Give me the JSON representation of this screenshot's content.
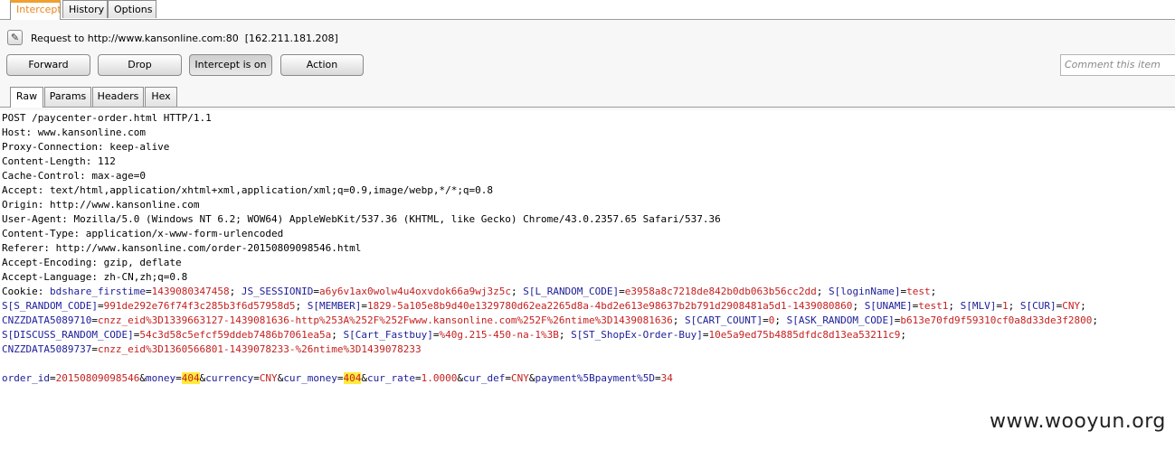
{
  "top_tabs": [
    "Intercept",
    "History",
    "Options"
  ],
  "request": {
    "label": "Request to http://www.kansonline.com:80",
    "ip": "[162.211.181.208]"
  },
  "buttons": {
    "forward": "Forward",
    "drop": "Drop",
    "intercept": "Intercept is on",
    "action": "Action"
  },
  "comment_placeholder": "Comment this item",
  "sub_tabs": [
    "Raw",
    "Params",
    "Headers",
    "Hex"
  ],
  "headers": [
    "POST /paycenter-order.html HTTP/1.1",
    "Host: www.kansonline.com",
    "Proxy-Connection: keep-alive",
    "Content-Length: 112",
    "Cache-Control: max-age=0",
    "Accept: text/html,application/xhtml+xml,application/xml;q=0.9,image/webp,*/*;q=0.8",
    "Origin: http://www.kansonline.com",
    "User-Agent: Mozilla/5.0 (Windows NT 6.2; WOW64) AppleWebKit/537.36 (KHTML, like Gecko) Chrome/43.0.2357.65 Safari/537.36",
    "Content-Type: application/x-www-form-urlencoded",
    "Referer: http://www.kansonline.com/order-20150809098546.html",
    "Accept-Encoding: gzip, deflate",
    "Accept-Language: zh-CN,zh;q=0.8"
  ],
  "cookie_lines": [
    [
      {
        "t": "Cookie: ",
        "c": "plain"
      },
      {
        "t": "bdshare_firstime",
        "c": "ck"
      },
      {
        "t": "=",
        "c": "plain"
      },
      {
        "t": "1439080347458",
        "c": "cv"
      },
      {
        "t": "; ",
        "c": "plain"
      },
      {
        "t": "JS_SESSIONID",
        "c": "ck"
      },
      {
        "t": "=",
        "c": "plain"
      },
      {
        "t": "a6y6v1ax0wolw4u4oxvdok66a9wj3z5c",
        "c": "cv"
      },
      {
        "t": "; ",
        "c": "plain"
      },
      {
        "t": "S[L_RANDOM_CODE]",
        "c": "ck"
      },
      {
        "t": "=",
        "c": "plain"
      },
      {
        "t": "e3958a8c7218de842b0db063b56cc2dd",
        "c": "cv"
      },
      {
        "t": "; ",
        "c": "plain"
      },
      {
        "t": "S[loginName]",
        "c": "ck"
      },
      {
        "t": "=",
        "c": "plain"
      },
      {
        "t": "test",
        "c": "cv"
      },
      {
        "t": ";",
        "c": "plain"
      }
    ],
    [
      {
        "t": "S[S_RANDOM_CODE]",
        "c": "ck"
      },
      {
        "t": "=",
        "c": "plain"
      },
      {
        "t": "991de292e76f74f3c285b3f6d57958d5",
        "c": "cv"
      },
      {
        "t": "; ",
        "c": "plain"
      },
      {
        "t": "S[MEMBER]",
        "c": "ck"
      },
      {
        "t": "=",
        "c": "plain"
      },
      {
        "t": "1829-5a105e8b9d40e1329780d62ea2265d8a-4bd2e613e98637b2b791d2908481a5d1-1439080860",
        "c": "cv"
      },
      {
        "t": "; ",
        "c": "plain"
      },
      {
        "t": "S[UNAME]",
        "c": "ck"
      },
      {
        "t": "=",
        "c": "plain"
      },
      {
        "t": "test1",
        "c": "cv"
      },
      {
        "t": "; ",
        "c": "plain"
      },
      {
        "t": "S[MLV]",
        "c": "ck"
      },
      {
        "t": "=",
        "c": "plain"
      },
      {
        "t": "1",
        "c": "cv"
      },
      {
        "t": "; ",
        "c": "plain"
      },
      {
        "t": "S[CUR]",
        "c": "ck"
      },
      {
        "t": "=",
        "c": "plain"
      },
      {
        "t": "CNY",
        "c": "cv"
      },
      {
        "t": ";",
        "c": "plain"
      }
    ],
    [
      {
        "t": "CNZZDATA5089710",
        "c": "ck"
      },
      {
        "t": "=",
        "c": "plain"
      },
      {
        "t": "cnzz_eid%3D1339663127-1439081636-http%253A%252F%252Fwww.kansonline.com%252F%26ntime%3D1439081636",
        "c": "cv"
      },
      {
        "t": "; ",
        "c": "plain"
      },
      {
        "t": "S[CART_COUNT]",
        "c": "ck"
      },
      {
        "t": "=",
        "c": "plain"
      },
      {
        "t": "0",
        "c": "cv"
      },
      {
        "t": "; ",
        "c": "plain"
      },
      {
        "t": "S[ASK_RANDOM_CODE]",
        "c": "ck"
      },
      {
        "t": "=",
        "c": "plain"
      },
      {
        "t": "b613e70fd9f59310cf0a8d33de3f2800",
        "c": "cv"
      },
      {
        "t": ";",
        "c": "plain"
      }
    ],
    [
      {
        "t": "S[DISCUSS_RANDOM_CODE]",
        "c": "ck"
      },
      {
        "t": "=",
        "c": "plain"
      },
      {
        "t": "54c3d58c5efcf59ddeb7486b7061ea5a",
        "c": "cv"
      },
      {
        "t": "; ",
        "c": "plain"
      },
      {
        "t": "S[Cart_Fastbuy]",
        "c": "ck"
      },
      {
        "t": "=",
        "c": "plain"
      },
      {
        "t": "%40g.215-450-na-1%3B",
        "c": "cv"
      },
      {
        "t": "; ",
        "c": "plain"
      },
      {
        "t": "S[ST_ShopEx-Order-Buy]",
        "c": "ck"
      },
      {
        "t": "=",
        "c": "plain"
      },
      {
        "t": "10e5a9ed75b4885dfdc8d13ea53211c9",
        "c": "cv"
      },
      {
        "t": ";",
        "c": "plain"
      }
    ],
    [
      {
        "t": "CNZZDATA5089737",
        "c": "ck"
      },
      {
        "t": "=",
        "c": "plain"
      },
      {
        "t": "cnzz_eid%3D1360566801-1439078233-%26ntime%3D1439078233",
        "c": "cv"
      }
    ]
  ],
  "body_params": [
    {
      "t": "order_id",
      "c": "ck"
    },
    {
      "t": "=",
      "c": "plain"
    },
    {
      "t": "20150809098546",
      "c": "cv"
    },
    {
      "t": "&",
      "c": "plain"
    },
    {
      "t": "money",
      "c": "ck"
    },
    {
      "t": "=",
      "c": "plain"
    },
    {
      "t": "404",
      "c": "hl"
    },
    {
      "t": "&",
      "c": "plain"
    },
    {
      "t": "currency",
      "c": "ck"
    },
    {
      "t": "=",
      "c": "plain"
    },
    {
      "t": "CNY",
      "c": "cv"
    },
    {
      "t": "&",
      "c": "plain"
    },
    {
      "t": "cur_money",
      "c": "ck"
    },
    {
      "t": "=",
      "c": "plain"
    },
    {
      "t": "404",
      "c": "hl"
    },
    {
      "t": "&",
      "c": "plain"
    },
    {
      "t": "cur_rate",
      "c": "ck"
    },
    {
      "t": "=",
      "c": "plain"
    },
    {
      "t": "1.0000",
      "c": "cv"
    },
    {
      "t": "&",
      "c": "plain"
    },
    {
      "t": "cur_def",
      "c": "ck"
    },
    {
      "t": "=",
      "c": "plain"
    },
    {
      "t": "CNY",
      "c": "cv"
    },
    {
      "t": "&",
      "c": "plain"
    },
    {
      "t": "payment%5Bpayment%5D",
      "c": "ck"
    },
    {
      "t": "=",
      "c": "plain"
    },
    {
      "t": "34",
      "c": "cv"
    }
  ],
  "watermark": "www.wooyun.org",
  "colors": {
    "accent": "#e8871e",
    "param_name": "#1c1c9a",
    "param_value": "#c51f1f",
    "highlight": "#ffeb3b"
  }
}
